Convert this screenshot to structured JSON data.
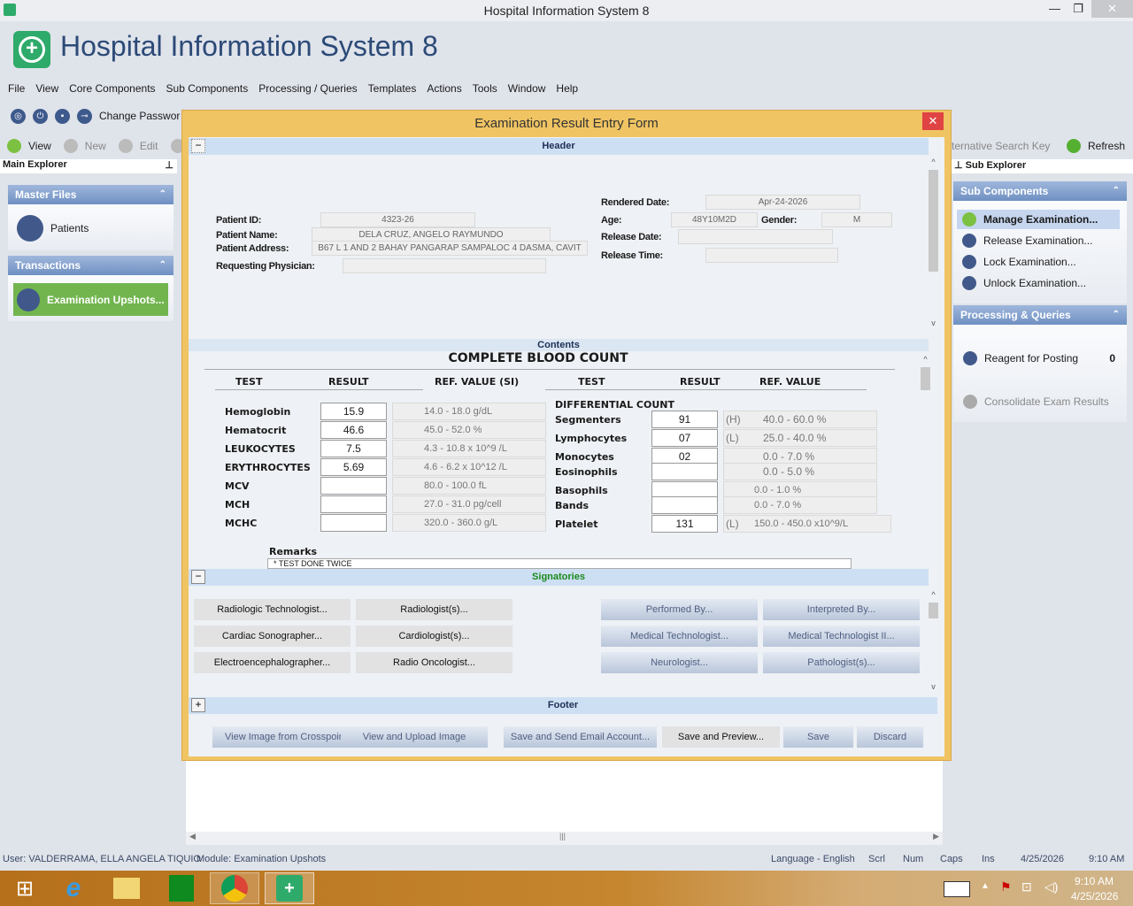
{
  "window": {
    "title": "Hospital Information System 8",
    "app_title": "Hospital Information System 8"
  },
  "menu": [
    "File",
    "View",
    "Core Components",
    "Sub Components",
    "Processing / Queries",
    "Templates",
    "Actions",
    "Tools",
    "Window",
    "Help"
  ],
  "toolbar1": {
    "change_password": "Change Passwor"
  },
  "toolbar2": {
    "view": "View",
    "new": "New",
    "edit": "Edit",
    "alt_search": "ternative Search Key",
    "refresh": "Refresh"
  },
  "main_explorer": {
    "title": "Main Explorer",
    "master_files": "Master Files",
    "patients": "Patients",
    "transactions": "Transactions",
    "exam_upshots": "Examination Upshots..."
  },
  "sub_explorer": {
    "title": "Sub Explorer",
    "sub_components": "Sub Components",
    "items": [
      "Manage Examination...",
      "Release Examination...",
      "Lock Examination...",
      "Unlock Examination..."
    ],
    "processing": "Processing & Queries",
    "reagent": "Reagent for Posting",
    "reagent_count": "0",
    "consolidate": "Consolidate Exam Results"
  },
  "dialog": {
    "title": "Examination Result Entry Form",
    "close": "✕"
  },
  "header": {
    "band": "Header",
    "toggle": "−",
    "patient_id_label": "Patient ID:",
    "patient_id": "4323-26",
    "patient_name_label": "Patient Name:",
    "patient_name": "DELA CRUZ, ANGELO RAYMUNDO",
    "patient_address_label": "Patient Address:",
    "patient_address": "B67 L 1 AND 2 BAHAY PANGARAP SAMPALOC 4 DASMA, CAVIT",
    "physician_label": "Requesting Physician:",
    "physician": "",
    "rendered_date_label": "Rendered Date:",
    "rendered_date": "Apr-24-2026",
    "age_label": "Age:",
    "age": "48Y10M2D",
    "gender_label": "Gender:",
    "gender": "M",
    "release_date_label": "Release Date:",
    "release_date": "",
    "release_time_label": "Release Time:",
    "release_time": ""
  },
  "contents": {
    "band": "Contents",
    "title": "COMPLETE BLOOD COUNT",
    "left_headers": [
      "TEST",
      "RESULT",
      "REF. VALUE (SI)"
    ],
    "right_headers": [
      "TEST",
      "RESULT",
      "REF. VALUE"
    ],
    "diff_title": "DIFFERENTIAL COUNT",
    "left_rows": [
      {
        "test": "Hemoglobin",
        "result": "15.9",
        "ref": "14.0 - 18.0 g/dL"
      },
      {
        "test": "Hematocrit",
        "result": "46.6",
        "ref": "45.0 - 52.0 %"
      },
      {
        "test": "LEUKOCYTES",
        "result": "7.5",
        "ref": "4.3 - 10.8 x 10^9 /L"
      },
      {
        "test": "ERYTHROCYTES",
        "result": "5.69",
        "ref": "4.6 - 6.2 x 10^12 /L"
      },
      {
        "test": "MCV",
        "result": "",
        "ref": "80.0 - 100.0 fL"
      },
      {
        "test": "MCH",
        "result": "",
        "ref": "27.0 - 31.0 pg/cell"
      },
      {
        "test": "MCHC",
        "result": "",
        "ref": "320.0 - 360.0 g/L"
      }
    ],
    "right_rows": [
      {
        "test": "Segmenters",
        "result": "91",
        "flag": "(H)",
        "ref": "40.0 - 60.0 %"
      },
      {
        "test": "Lymphocytes",
        "result": "07",
        "flag": "(L)",
        "ref": "25.0 - 40.0 %"
      },
      {
        "test": "Monocytes",
        "result": "02",
        "flag": "",
        "ref": "0.0 - 7.0 %"
      },
      {
        "test": "Eosinophils",
        "result": "",
        "flag": "",
        "ref": "0.0 - 5.0 %"
      },
      {
        "test": "Basophils",
        "result": "",
        "flag": "",
        "ref": "0.0 - 1.0 %"
      },
      {
        "test": "Bands",
        "result": "",
        "flag": "",
        "ref": "0.0 - 7.0 %"
      },
      {
        "test": "Platelet",
        "result": "131",
        "flag": "(L)",
        "ref": "150.0 - 450.0 x10^9/L"
      }
    ],
    "remarks_label": "Remarks",
    "remarks": "* TEST DONE TWICE"
  },
  "signatories": {
    "band": "Signatories",
    "toggle": "−",
    "left": [
      "Radiologic Technologist...",
      "Radiologist(s)...",
      "Cardiac Sonographer...",
      "Cardiologist(s)...",
      "Electroencephalographer...",
      "Radio Oncologist..."
    ],
    "right": [
      "Performed By...",
      "Interpreted By...",
      "Medical Technologist...",
      "Medical Technologist II...",
      "Neurologist...",
      "Pathologist(s)..."
    ]
  },
  "footer": {
    "band": "Footer",
    "toggle": "+",
    "buttons": [
      "View Image from Crosspoint",
      "View and Upload Image",
      "Save and Send Email Account...",
      "Save and Preview...",
      "Save",
      "Discard"
    ]
  },
  "status": {
    "user": "User: VALDERRAMA, ELLA ANGELA TIQUIO",
    "module": "Module: Examination Upshots",
    "language": "Language - English",
    "scrl": "Scrl",
    "num": "Num",
    "caps": "Caps",
    "ins": "Ins",
    "date": "4/25/2026",
    "time": "9:10 AM"
  },
  "taskbar": {
    "time": "9:10 AM",
    "date": "4/25/2026"
  },
  "colors": {
    "dialog_border": "#f0c463",
    "band": "#cddff3",
    "selected_nav": "#72b54f",
    "close": "#e04343"
  }
}
